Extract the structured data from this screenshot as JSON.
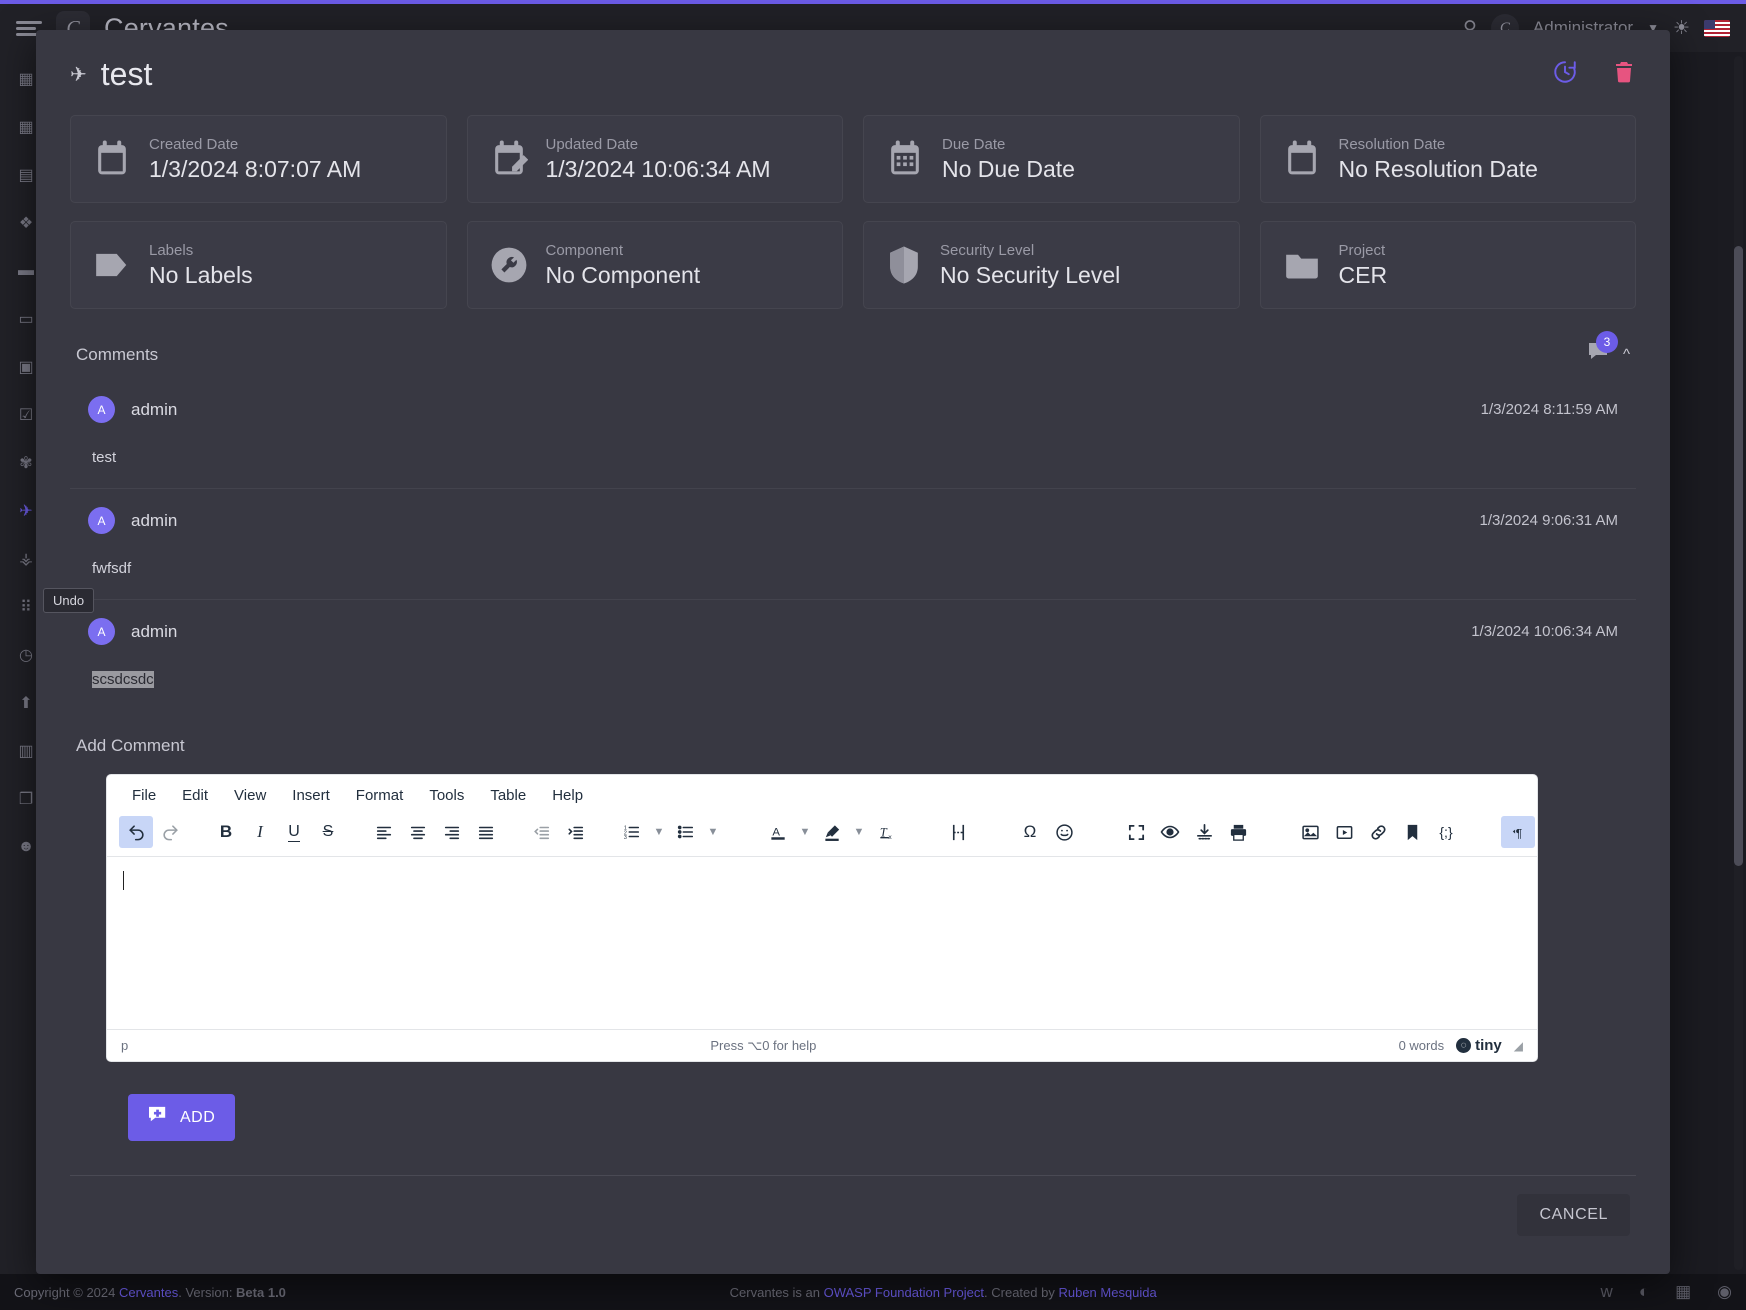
{
  "topbar": {
    "app_title": "Cervantes",
    "burger_icon": "hamburger-menu-icon",
    "search_icon": "search-icon",
    "user_name": "Administrator",
    "theme_icon": "sun-icon",
    "language_flag": "us-flag-icon"
  },
  "sidebar": {
    "items": [
      {
        "name": "dashboard",
        "icon": "dashboard-grid-icon",
        "glyph": "▧"
      },
      {
        "name": "calendar",
        "icon": "calendar-icon",
        "glyph": "▦"
      },
      {
        "name": "knowledge-base",
        "icon": "book-icon",
        "glyph": "▤"
      },
      {
        "name": "clients",
        "icon": "people-group-icon",
        "glyph": "❖"
      },
      {
        "name": "projects",
        "icon": "folder-icon",
        "glyph": "▬"
      },
      {
        "name": "vault",
        "icon": "briefcase-icon",
        "glyph": "▭"
      },
      {
        "name": "reports",
        "icon": "document-icon",
        "glyph": "▣"
      },
      {
        "name": "tasks",
        "icon": "checklist-icon",
        "glyph": "☑"
      },
      {
        "name": "vulns",
        "icon": "bug-icon",
        "glyph": "✾"
      },
      {
        "name": "jira",
        "icon": "pin-icon",
        "glyph": "✈"
      },
      {
        "name": "security",
        "icon": "shield-icon",
        "glyph": "⛊"
      },
      {
        "name": "apps",
        "icon": "apps-grid-icon",
        "glyph": "⠿"
      },
      {
        "name": "history",
        "icon": "clock-icon",
        "glyph": "◷"
      },
      {
        "name": "uploads",
        "icon": "upload-icon",
        "glyph": "⬆"
      },
      {
        "name": "profile",
        "icon": "id-card-icon",
        "glyph": "▥"
      },
      {
        "name": "templates",
        "icon": "copy-icon",
        "glyph": "❐"
      },
      {
        "name": "users",
        "icon": "user-icon",
        "glyph": "☻"
      }
    ]
  },
  "modal": {
    "title": "test",
    "title_icon": "jira-pin-icon",
    "actions": {
      "history_icon": "restore-history-icon",
      "delete_icon": "trash-delete-icon"
    },
    "cards": [
      {
        "label": "Created Date",
        "value": "1/3/2024 8:07:07 AM",
        "icon": "calendar-icon"
      },
      {
        "label": "Updated Date",
        "value": "1/3/2024 10:06:34 AM",
        "icon": "calendar-edit-icon"
      },
      {
        "label": "Due Date",
        "value": "No Due Date",
        "icon": "calendar-days-icon"
      },
      {
        "label": "Resolution Date",
        "value": "No Resolution Date",
        "icon": "calendar-blank-icon"
      },
      {
        "label": "Labels",
        "value": "No Labels",
        "icon": "tag-label-icon"
      },
      {
        "label": "Component",
        "value": "No Component",
        "icon": "wrench-component-icon"
      },
      {
        "label": "Security Level",
        "value": "No Security Level",
        "icon": "shield-security-icon"
      },
      {
        "label": "Project",
        "value": "CER",
        "icon": "folder-project-icon"
      }
    ],
    "comments_section": {
      "title": "Comments",
      "count_badge": "3",
      "comment_icon": "comment-bubble-icon",
      "collapse_icon": "chevron-up-icon",
      "comments": [
        {
          "author": "admin",
          "avatar_initial": "A",
          "date": "1/3/2024 8:11:59 AM",
          "body": "test",
          "selected": false
        },
        {
          "author": "admin",
          "avatar_initial": "A",
          "date": "1/3/2024 9:06:31 AM",
          "body": "fwfsdf",
          "selected": false
        },
        {
          "author": "admin",
          "avatar_initial": "A",
          "date": "1/3/2024 10:06:34 AM",
          "body": "scsdcsdc",
          "selected": true
        }
      ]
    },
    "add_comment": {
      "label": "Add Comment",
      "add_button_label": "ADD",
      "add_button_icon": "comment-plus-icon"
    },
    "cancel_label": "CANCEL"
  },
  "editor": {
    "menus": [
      "File",
      "Edit",
      "View",
      "Insert",
      "Format",
      "Tools",
      "Table",
      "Help"
    ],
    "toolbar": [
      {
        "name": "undo-button",
        "icon": "undo-arrow-icon",
        "active": true
      },
      {
        "name": "redo-button",
        "icon": "redo-arrow-icon",
        "active": false
      },
      {
        "name": "bold-button",
        "icon": "bold-B-icon",
        "active": false
      },
      {
        "name": "italic-button",
        "icon": "italic-I-icon",
        "active": false
      },
      {
        "name": "underline-button",
        "icon": "underline-U-icon",
        "active": false
      },
      {
        "name": "strikethrough-button",
        "icon": "strikethrough-S-icon",
        "active": false
      },
      {
        "name": "align-left-button",
        "icon": "align-left-icon",
        "active": false
      },
      {
        "name": "align-center-button",
        "icon": "align-center-icon",
        "active": false
      },
      {
        "name": "align-right-button",
        "icon": "align-right-icon",
        "active": false
      },
      {
        "name": "align-justify-button",
        "icon": "align-justify-icon",
        "active": false
      },
      {
        "name": "outdent-button",
        "icon": "outdent-icon",
        "active": false
      },
      {
        "name": "indent-button",
        "icon": "indent-icon",
        "active": false
      },
      {
        "name": "numbered-list-button",
        "icon": "numbered-list-icon",
        "active": false
      },
      {
        "name": "bullet-list-button",
        "icon": "bullet-list-icon",
        "active": false
      },
      {
        "name": "text-color-button",
        "icon": "text-color-A-icon",
        "active": false
      },
      {
        "name": "highlight-color-button",
        "icon": "highlight-pen-icon",
        "active": false
      },
      {
        "name": "clear-format-button",
        "icon": "clear-formatting-icon",
        "active": false
      },
      {
        "name": "page-break-button",
        "icon": "page-break-icon",
        "active": false
      },
      {
        "name": "special-char-button",
        "icon": "omega-special-char-icon",
        "active": false
      },
      {
        "name": "emoticons-button",
        "icon": "smiley-emoji-icon",
        "active": false
      },
      {
        "name": "fullscreen-button",
        "icon": "fullscreen-expand-icon",
        "active": false
      },
      {
        "name": "preview-button",
        "icon": "eye-preview-icon",
        "active": false
      },
      {
        "name": "export-button",
        "icon": "download-export-icon",
        "active": false
      },
      {
        "name": "print-button",
        "icon": "printer-icon",
        "active": false
      },
      {
        "name": "insert-image-button",
        "icon": "image-picture-icon",
        "active": false
      },
      {
        "name": "insert-media-button",
        "icon": "media-play-icon",
        "active": false
      },
      {
        "name": "insert-link-button",
        "icon": "link-chain-icon",
        "active": false
      },
      {
        "name": "anchor-button",
        "icon": "bookmark-anchor-icon",
        "active": false
      },
      {
        "name": "source-code-button",
        "icon": "source-code-icon",
        "active": false
      },
      {
        "name": "ltr-button",
        "icon": "left-to-right-icon",
        "active": true
      },
      {
        "name": "rtl-button",
        "icon": "right-to-left-icon",
        "active": false
      }
    ],
    "content": "",
    "status": {
      "element_path": "p",
      "help_text": "Press ⌥0 for help",
      "word_count": "0 words",
      "brand": "tiny"
    }
  },
  "tooltip": {
    "undo_label": "Undo"
  },
  "footer": {
    "copyright_prefix": "Copyright © 2024 ",
    "brand": "Cervantes",
    "version_text": ". Version: ",
    "version": "Beta 1.0",
    "center_prefix": "Cervantes is an ",
    "center_link": "OWASP Foundation Project",
    "center_mid": ". Created by ",
    "center_author": "Ruben Mesquida",
    "social": [
      "twitter-icon",
      "discord-icon",
      "docs-icon",
      "github-icon"
    ]
  },
  "colors": {
    "accent": "#6c5ce7",
    "danger": "#e75480",
    "modal_bg": "#383842",
    "card_bg": "#3b3b46"
  }
}
